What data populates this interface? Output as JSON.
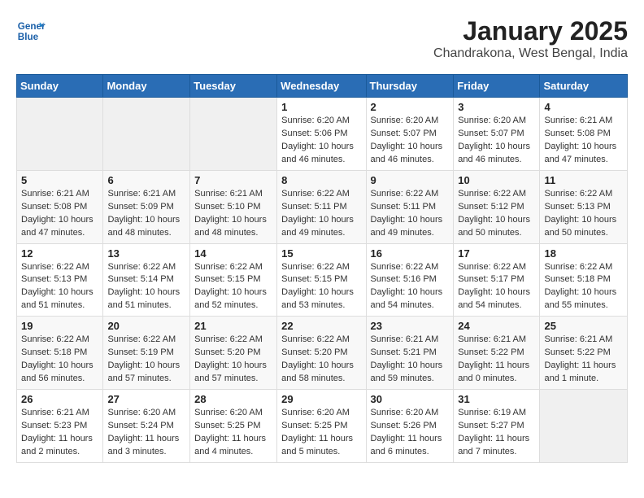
{
  "header": {
    "logo_line1": "General",
    "logo_line2": "Blue",
    "month": "January 2025",
    "location": "Chandrakona, West Bengal, India"
  },
  "weekdays": [
    "Sunday",
    "Monday",
    "Tuesday",
    "Wednesday",
    "Thursday",
    "Friday",
    "Saturday"
  ],
  "weeks": [
    [
      {
        "day": "",
        "content": ""
      },
      {
        "day": "",
        "content": ""
      },
      {
        "day": "",
        "content": ""
      },
      {
        "day": "1",
        "content": "Sunrise: 6:20 AM\nSunset: 5:06 PM\nDaylight: 10 hours\nand 46 minutes."
      },
      {
        "day": "2",
        "content": "Sunrise: 6:20 AM\nSunset: 5:07 PM\nDaylight: 10 hours\nand 46 minutes."
      },
      {
        "day": "3",
        "content": "Sunrise: 6:20 AM\nSunset: 5:07 PM\nDaylight: 10 hours\nand 46 minutes."
      },
      {
        "day": "4",
        "content": "Sunrise: 6:21 AM\nSunset: 5:08 PM\nDaylight: 10 hours\nand 47 minutes."
      }
    ],
    [
      {
        "day": "5",
        "content": "Sunrise: 6:21 AM\nSunset: 5:08 PM\nDaylight: 10 hours\nand 47 minutes."
      },
      {
        "day": "6",
        "content": "Sunrise: 6:21 AM\nSunset: 5:09 PM\nDaylight: 10 hours\nand 48 minutes."
      },
      {
        "day": "7",
        "content": "Sunrise: 6:21 AM\nSunset: 5:10 PM\nDaylight: 10 hours\nand 48 minutes."
      },
      {
        "day": "8",
        "content": "Sunrise: 6:22 AM\nSunset: 5:11 PM\nDaylight: 10 hours\nand 49 minutes."
      },
      {
        "day": "9",
        "content": "Sunrise: 6:22 AM\nSunset: 5:11 PM\nDaylight: 10 hours\nand 49 minutes."
      },
      {
        "day": "10",
        "content": "Sunrise: 6:22 AM\nSunset: 5:12 PM\nDaylight: 10 hours\nand 50 minutes."
      },
      {
        "day": "11",
        "content": "Sunrise: 6:22 AM\nSunset: 5:13 PM\nDaylight: 10 hours\nand 50 minutes."
      }
    ],
    [
      {
        "day": "12",
        "content": "Sunrise: 6:22 AM\nSunset: 5:13 PM\nDaylight: 10 hours\nand 51 minutes."
      },
      {
        "day": "13",
        "content": "Sunrise: 6:22 AM\nSunset: 5:14 PM\nDaylight: 10 hours\nand 51 minutes."
      },
      {
        "day": "14",
        "content": "Sunrise: 6:22 AM\nSunset: 5:15 PM\nDaylight: 10 hours\nand 52 minutes."
      },
      {
        "day": "15",
        "content": "Sunrise: 6:22 AM\nSunset: 5:15 PM\nDaylight: 10 hours\nand 53 minutes."
      },
      {
        "day": "16",
        "content": "Sunrise: 6:22 AM\nSunset: 5:16 PM\nDaylight: 10 hours\nand 54 minutes."
      },
      {
        "day": "17",
        "content": "Sunrise: 6:22 AM\nSunset: 5:17 PM\nDaylight: 10 hours\nand 54 minutes."
      },
      {
        "day": "18",
        "content": "Sunrise: 6:22 AM\nSunset: 5:18 PM\nDaylight: 10 hours\nand 55 minutes."
      }
    ],
    [
      {
        "day": "19",
        "content": "Sunrise: 6:22 AM\nSunset: 5:18 PM\nDaylight: 10 hours\nand 56 minutes."
      },
      {
        "day": "20",
        "content": "Sunrise: 6:22 AM\nSunset: 5:19 PM\nDaylight: 10 hours\nand 57 minutes."
      },
      {
        "day": "21",
        "content": "Sunrise: 6:22 AM\nSunset: 5:20 PM\nDaylight: 10 hours\nand 57 minutes."
      },
      {
        "day": "22",
        "content": "Sunrise: 6:22 AM\nSunset: 5:20 PM\nDaylight: 10 hours\nand 58 minutes."
      },
      {
        "day": "23",
        "content": "Sunrise: 6:21 AM\nSunset: 5:21 PM\nDaylight: 10 hours\nand 59 minutes."
      },
      {
        "day": "24",
        "content": "Sunrise: 6:21 AM\nSunset: 5:22 PM\nDaylight: 11 hours\nand 0 minutes."
      },
      {
        "day": "25",
        "content": "Sunrise: 6:21 AM\nSunset: 5:22 PM\nDaylight: 11 hours\nand 1 minute."
      }
    ],
    [
      {
        "day": "26",
        "content": "Sunrise: 6:21 AM\nSunset: 5:23 PM\nDaylight: 11 hours\nand 2 minutes."
      },
      {
        "day": "27",
        "content": "Sunrise: 6:20 AM\nSunset: 5:24 PM\nDaylight: 11 hours\nand 3 minutes."
      },
      {
        "day": "28",
        "content": "Sunrise: 6:20 AM\nSunset: 5:25 PM\nDaylight: 11 hours\nand 4 minutes."
      },
      {
        "day": "29",
        "content": "Sunrise: 6:20 AM\nSunset: 5:25 PM\nDaylight: 11 hours\nand 5 minutes."
      },
      {
        "day": "30",
        "content": "Sunrise: 6:20 AM\nSunset: 5:26 PM\nDaylight: 11 hours\nand 6 minutes."
      },
      {
        "day": "31",
        "content": "Sunrise: 6:19 AM\nSunset: 5:27 PM\nDaylight: 11 hours\nand 7 minutes."
      },
      {
        "day": "",
        "content": ""
      }
    ]
  ]
}
